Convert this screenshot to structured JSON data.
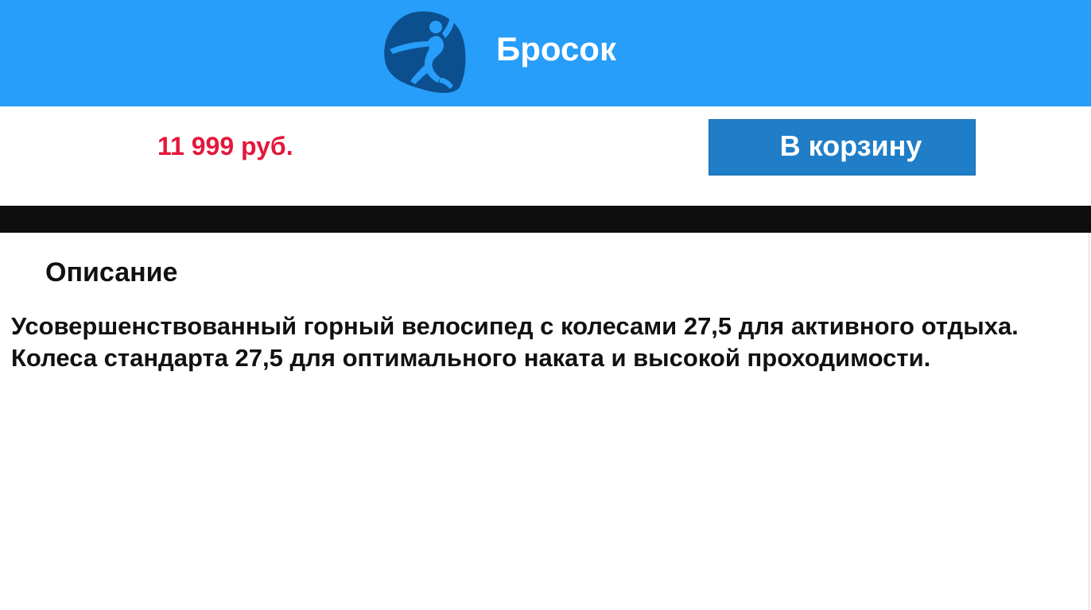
{
  "header": {
    "logo_icon": "handball-player-icon",
    "title": "Бросок",
    "background_color": "#279ef9"
  },
  "product": {
    "price": "11 999 руб.",
    "price_color": "#e4173b",
    "add_to_cart_label": "В корзину"
  },
  "description": {
    "heading": "Описание",
    "lines": [
      "Усовершенствованный горный велосипед с колесами 27,5 для активного отдыха.",
      "Колеса стандарта 27,5 для оптимального наката и высокой проходимости."
    ]
  }
}
